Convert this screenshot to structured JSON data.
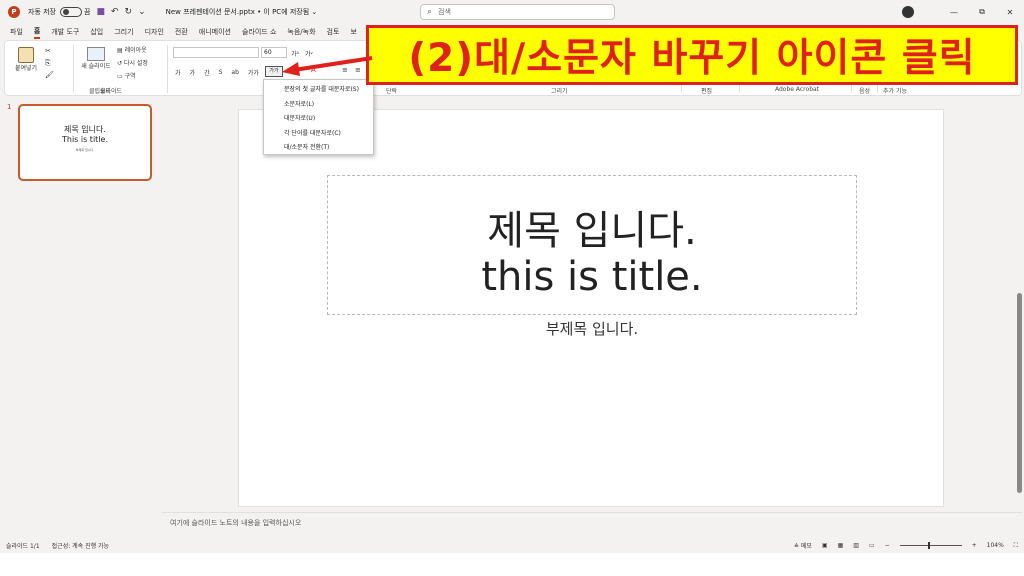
{
  "titlebar": {
    "app_logo": "P",
    "autosave_label": "자동 저장",
    "autosave_state": "끔",
    "filename": "New 프레젠테이션 문서.pptx • 이 PC에 저장됨 ⌄",
    "search_placeholder": "검색",
    "win_min": "—",
    "win_max": "⧉",
    "win_close": "✕"
  },
  "menu_tabs": [
    "파일",
    "홈",
    "개발 도구",
    "삽입",
    "그리기",
    "디자인",
    "전환",
    "애니메이션",
    "슬라이드 쇼",
    "녹음/녹화",
    "검토",
    "보"
  ],
  "ribbon": {
    "paste_label": "붙여넣기",
    "new_slide_label": "새 슬라이드",
    "layout_label": "레이아웃",
    "reset_label": "다시 설정",
    "section_label": "구역",
    "font_size": "60",
    "case_button_label": "가가",
    "format_buttons": [
      "가",
      "가",
      "간",
      "S",
      "ab",
      "가가"
    ],
    "groups": [
      "클립보드",
      "슬라이드",
      "글꼴",
      "단락",
      "그리기",
      "편집",
      "Adobe Acrobat",
      "음성",
      "추가 기능"
    ]
  },
  "case_menu": {
    "items": [
      "문장의 첫 글자를 대문자로(S)",
      "소문자로(L)",
      "대문자로(U)",
      "각 단어를 대문자로(C)",
      "대/소문자 전환(T)"
    ]
  },
  "thumbnail": {
    "number": "1",
    "line1": "제목 입니다.",
    "line2": "This is title.",
    "line3": "부제목 입니다."
  },
  "slide": {
    "title_line1": "제목 입니다.",
    "title_line2": "this is title.",
    "subtitle": "부제목 입니다."
  },
  "notes_placeholder": "여기에 슬라이드 노트의 내용을 입력하십시오",
  "statusbar": {
    "slide_info": "슬라이드 1/1",
    "accessibility": "접근성: 계속 진행 가능",
    "notes_label": "메모",
    "zoom": "104%"
  },
  "annotation": {
    "text": "(2)대/소문자 바꾸기 아이콘 클릭"
  },
  "colors": {
    "accent": "#c43e1c",
    "callout_bg": "#ffff00",
    "callout_text": "#e0201b"
  }
}
